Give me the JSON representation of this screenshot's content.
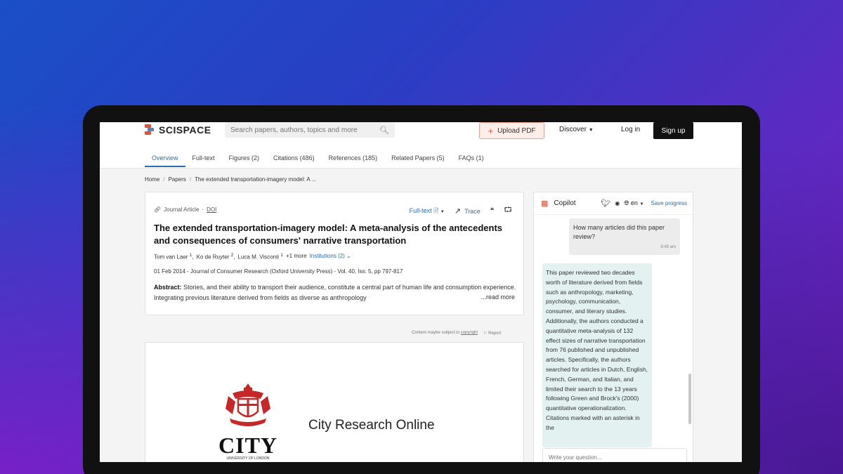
{
  "header": {
    "logo_text": "SCISPACE",
    "search_placeholder": "Search papers, authors, topics and more",
    "upload_label": "Upload PDF",
    "discover_label": "Discover",
    "login_label": "Log in",
    "signup_label": "Sign up"
  },
  "tabs": [
    {
      "label": "Overview",
      "active": true
    },
    {
      "label": "Full-text"
    },
    {
      "label": "Figures (2)"
    },
    {
      "label": "Citations (486)"
    },
    {
      "label": "References (185)"
    },
    {
      "label": "Related Papers (5)"
    },
    {
      "label": "FAQs (1)"
    }
  ],
  "breadcrumb": {
    "home": "Home",
    "papers": "Papers",
    "current": "The extended transportation-imagery model: A ..."
  },
  "article": {
    "type": "Journal Article",
    "doi_label": "DOI",
    "fulltext_label": "Full-text",
    "trace_label": "Trace",
    "title": "The extended transportation-imagery model: A meta-analysis of the antecedents and consequences of consumers' narrative transportation",
    "authors": [
      "Tom van Laer",
      "Ko de Ruyter",
      "Luca M. Visconti"
    ],
    "author_sup": [
      "1",
      "2",
      "1"
    ],
    "more_authors": "+1 more",
    "institutions": "Institutions (2)",
    "pubinfo": "01 Feb 2014 - Journal of Consumer Research (Oxford University Press) - Vol. 40, Iss: 5, pp 797-817",
    "abstract_label": "Abstract:",
    "abstract_text": "Stories, and their ability to transport their audience, constitute a central part of human life and consumption experience. Integrating previous literature derived from fields as diverse as anthropology",
    "readmore": "...read more"
  },
  "content_note": {
    "text": "Content maybe subject to",
    "copyright": "copyright",
    "report": "Report"
  },
  "pdf": {
    "logo_text": "CITY",
    "logo_sub": "UNIVERSITY OF LONDON",
    "repo_title": "City Research Online"
  },
  "copilot": {
    "title": "Copilot",
    "lang": "en",
    "save_progress": "Save progress",
    "user_message": "How many articles did this paper review?",
    "user_time": "8:49 am",
    "bot_message": "This paper reviewed two decades worth of literature derived from fields such as anthropology, marketing, psychology, communication, consumer, and literary studies. Additionally, the authors conducted a quantitative meta-analysis of 132 effect sizes of narrative transportation from 76 published and unpublished articles. Specifically, the authors searched for articles in Dutch, English, French, German, and Italian, and limited their search to the 13 years following Green and Brock's (2000) quantitative operationalization. Citations marked with an asterisk in the",
    "question_placeholder": "Write your question..."
  },
  "colors": {
    "accent_blue": "#2b6cb0",
    "brand_red": "#e0523a"
  }
}
